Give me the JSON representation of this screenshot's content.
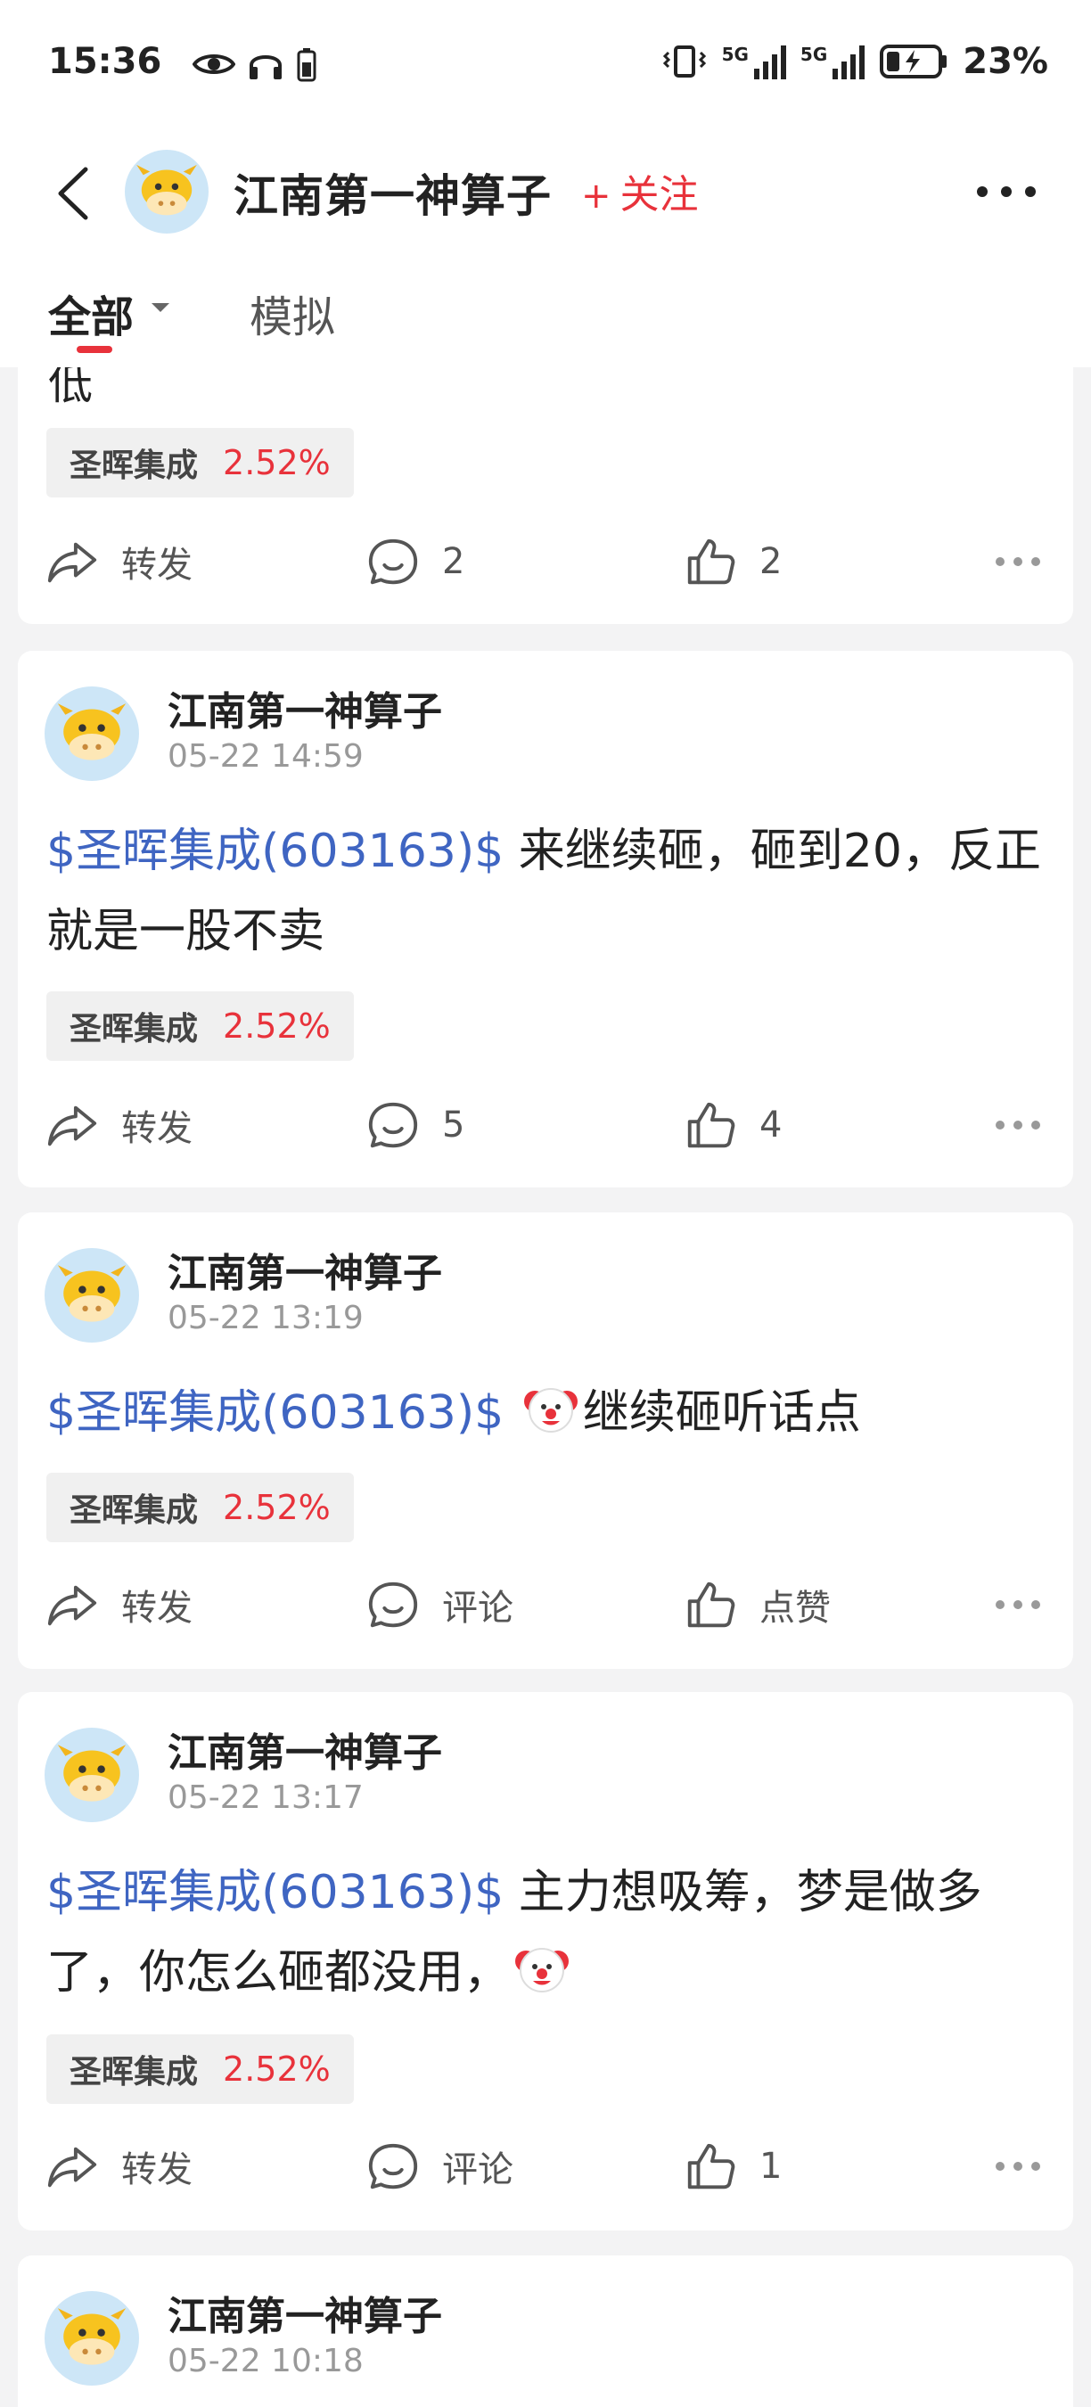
{
  "status": {
    "time": "15:36",
    "signal_1": "5G",
    "signal_2": "5G",
    "battery": "23%"
  },
  "nav": {
    "title": "江南第一神算子",
    "follow_label": "关注",
    "follow_plus": "+"
  },
  "tabs": {
    "all": "全部",
    "simulated": "模拟"
  },
  "labels": {
    "share": "转发"
  },
  "partial_post": {
    "text_fragment": "低",
    "tag_name": "圣晖集成",
    "tag_pct": "2.52%",
    "comments": "2",
    "likes": "2"
  },
  "posts": [
    {
      "author": "江南第一神算子",
      "time": "05-22 14:59",
      "stock_link": "$圣晖集成(603163)$",
      "text": " 来继续砸，砸到20，反正就是一股不卖",
      "tag_name": "圣晖集成",
      "tag_pct": "2.52%",
      "comments": "5",
      "likes": "4"
    },
    {
      "author": "江南第一神算子",
      "time": "05-22 13:19",
      "stock_link": "$圣晖集成(603163)$",
      "text": "继续砸听话点",
      "tag_name": "圣晖集成",
      "tag_pct": "2.52%",
      "comments": "评论",
      "likes": "点赞"
    },
    {
      "author": "江南第一神算子",
      "time": "05-22 13:17",
      "stock_link": "$圣晖集成(603163)$",
      "text": " 主力想吸筹，梦是做多了，你怎么砸都没用，",
      "tag_name": "圣晖集成",
      "tag_pct": "2.52%",
      "comments": "评论",
      "likes": "1"
    },
    {
      "author": "江南第一神算子",
      "time": "05-22 10:18"
    }
  ],
  "colors": {
    "accent_red": "#e8323b",
    "stock_link_blue": "#3f65c2",
    "background": "#f3f3f4"
  }
}
